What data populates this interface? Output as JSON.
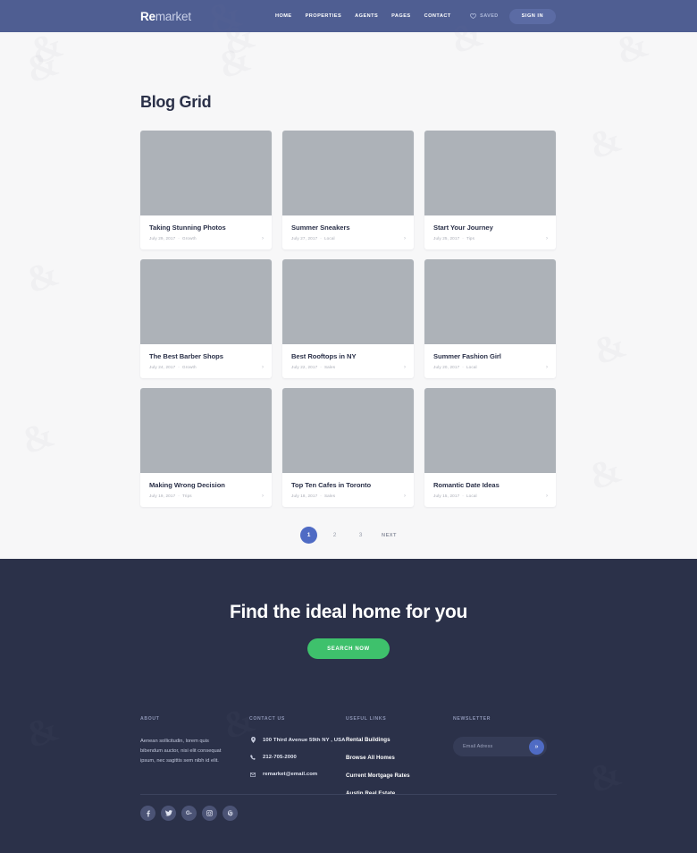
{
  "header": {
    "logo_bold": "Re",
    "logo_rest": "market",
    "nav": [
      {
        "label": "HOME"
      },
      {
        "label": "PROPERTIES"
      },
      {
        "label": "AGENTS"
      },
      {
        "label": "PAGES"
      },
      {
        "label": "CONTACT"
      }
    ],
    "saved_label": "SAVED",
    "saved_icon": "heart-icon",
    "signin_label": "SIGN IN",
    "bg_color": "#4f5e92"
  },
  "main": {
    "page_title": "Blog Grid",
    "bg_color": "#f7f7f8",
    "cards": [
      {
        "title": "Taking Stunning Photos",
        "date": "July 29, 2017",
        "category": "Growth",
        "arrow": "›"
      },
      {
        "title": "Summer Sneakers",
        "date": "July 27, 2017",
        "category": "Local",
        "arrow": "›"
      },
      {
        "title": "Start Your Journey",
        "date": "July 25, 2017",
        "category": "Tips",
        "arrow": "›"
      },
      {
        "title": "The Best Barber Shops",
        "date": "July 24, 2017",
        "category": "Growth",
        "arrow": "›"
      },
      {
        "title": "Best Rooftops in NY",
        "date": "July 22, 2017",
        "category": "Sales",
        "arrow": "›"
      },
      {
        "title": "Summer Fashion Girl",
        "date": "July 20, 2017",
        "category": "Local",
        "arrow": "›"
      },
      {
        "title": "Making Wrong Decision",
        "date": "July 19, 2017",
        "category": "Trips",
        "arrow": "›"
      },
      {
        "title": "Top Ten Cafes in Toronto",
        "date": "July 18, 2017",
        "category": "Sales",
        "arrow": "›"
      },
      {
        "title": "Romantic Date Ideas",
        "date": "July 15, 2017",
        "category": "Local",
        "arrow": "›"
      }
    ],
    "pagination": {
      "pages": [
        "1",
        "2",
        "3"
      ],
      "active_page": "1",
      "next_label": "NEXT",
      "active_color": "#4f6bc4"
    }
  },
  "cta": {
    "title": "Find the ideal home for you",
    "button_label": "SEARCH NOW",
    "button_color": "#3ec16c",
    "bg_color": "#2b3149"
  },
  "footer": {
    "about": {
      "heading": "ABOUT",
      "text": "Aenean sollicitudin, lorem quis bibendum auctor, nisi elit consequat ipsum, nec sagittis sem nibh id elit."
    },
    "contact": {
      "heading": "CONTACT US",
      "items": [
        {
          "icon": "map-pin-icon",
          "value": "100 Third Avenue 59th NY , USA"
        },
        {
          "icon": "phone-icon",
          "value": "212-705-2000"
        },
        {
          "icon": "envelope-icon",
          "value": "remarket@email.com"
        }
      ]
    },
    "links": {
      "heading": "USEFUL LINKS",
      "items": [
        {
          "label": "Rental Buildings"
        },
        {
          "label": "Browse All Homes"
        },
        {
          "label": "Current Mortgage Rates"
        },
        {
          "label": "Austin Real Estate"
        }
      ]
    },
    "newsletter": {
      "heading": "NEWSLETTER",
      "placeholder": "Email Adress",
      "value": "",
      "submit_icon": "double-chevron-right-icon"
    },
    "social": [
      {
        "name": "facebook-icon",
        "glyph": "f"
      },
      {
        "name": "twitter-icon",
        "glyph": "t"
      },
      {
        "name": "google-plus-icon",
        "glyph": "G+"
      },
      {
        "name": "instagram-icon",
        "glyph": "o"
      },
      {
        "name": "pinterest-icon",
        "glyph": "P"
      }
    ]
  }
}
